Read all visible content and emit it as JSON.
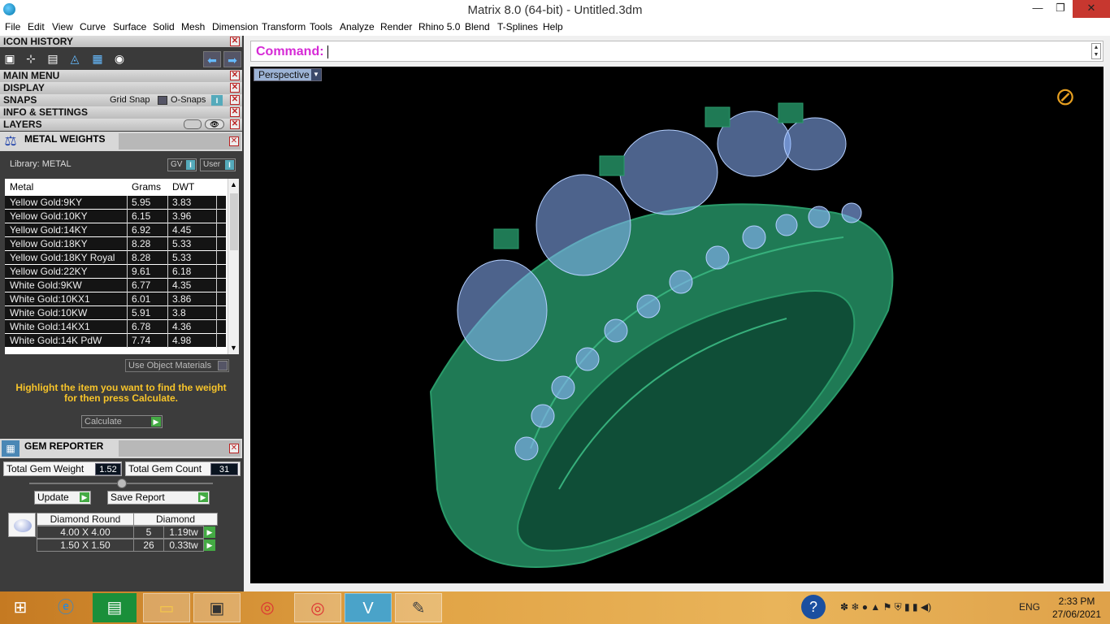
{
  "window": {
    "title": "Matrix 8.0 (64-bit) - Untitled.3dm",
    "min": "—",
    "max": "❐",
    "close": "✕"
  },
  "menu": [
    "File",
    "Edit",
    "View",
    "Curve",
    "Surface",
    "Solid",
    "Mesh",
    "Dimension",
    "Transform",
    "Tools",
    "Analyze",
    "Render",
    "Rhino 5.0",
    "Blend",
    "T-Splines",
    "Help"
  ],
  "panels": {
    "icon_history": "ICON HISTORY",
    "main_menu": "MAIN MENU",
    "display": "DISPLAY",
    "snaps": "SNAPS",
    "grid_snap": "Grid Snap",
    "o_snaps": "O-Snaps",
    "info_settings": "INFO & SETTINGS",
    "layers": "LAYERS"
  },
  "metal_weights": {
    "title": "METAL WEIGHTS",
    "library": "Library: METAL",
    "gv": "GV",
    "user": "User",
    "toggle_mark": "I",
    "headers": [
      "Metal",
      "Grams",
      "DWT"
    ],
    "rows": [
      [
        "Yellow Gold:9KY",
        "5.95",
        "3.83"
      ],
      [
        "Yellow Gold:10KY",
        "6.15",
        "3.96"
      ],
      [
        "Yellow Gold:14KY",
        "6.92",
        "4.45"
      ],
      [
        "Yellow Gold:18KY",
        "8.28",
        "5.33"
      ],
      [
        "Yellow Gold:18KY Royal",
        "8.28",
        "5.33"
      ],
      [
        "Yellow Gold:22KY",
        "9.61",
        "6.18"
      ],
      [
        "White Gold:9KW",
        "6.77",
        "4.35"
      ],
      [
        "White Gold:10KX1",
        "6.01",
        "3.86"
      ],
      [
        "White Gold:10KW",
        "5.91",
        "3.8"
      ],
      [
        "White Gold:14KX1",
        "6.78",
        "4.36"
      ],
      [
        "White Gold:14K PdW",
        "7.74",
        "4.98"
      ]
    ],
    "use_object_materials": "Use Object Materials",
    "hint": "Highlight the item you want to find the weight for then press Calculate.",
    "calculate": "Calculate"
  },
  "gem_reporter": {
    "title": "GEM REPORTER",
    "total_weight_label": "Total Gem Weight",
    "total_weight": "1.52",
    "total_count_label": "Total Gem Count",
    "total_count": "31",
    "update": "Update",
    "save_report": "Save Report",
    "header_shape": "Diamond Round",
    "header_material": "Diamond",
    "rows": [
      {
        "size": "4.00 X 4.00",
        "count": "5",
        "weight": "1.19tw"
      },
      {
        "size": "1.50 X 1.50",
        "count": "26",
        "weight": "0.33tw"
      }
    ]
  },
  "command": {
    "label": "Command:"
  },
  "viewport": {
    "name": "Perspective"
  },
  "taskbar": {
    "language": "ENG",
    "time": "2:33 PM",
    "date": "27/06/2021"
  },
  "colors": {
    "accent_command": "#d62ad6",
    "hint": "#f7c42a",
    "ring": "#1f7a55",
    "gem": "#8db4ff"
  }
}
